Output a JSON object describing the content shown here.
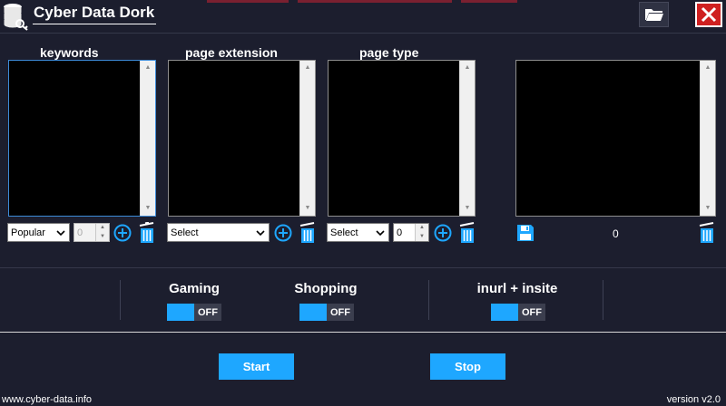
{
  "window": {
    "title": "Cyber Data Dork"
  },
  "icons": {
    "app": "database-key-icon",
    "folder": "folder-open-icon",
    "close": "close-x-icon",
    "add": "plus-circle-icon",
    "delete": "trash-icon",
    "save": "floppy-disk-icon"
  },
  "groups": {
    "keywords": {
      "title": "keywords",
      "select_value": "Popular",
      "spinner_value": "0"
    },
    "page_extension": {
      "title": "page extension",
      "select_value": "Select"
    },
    "page_type": {
      "title": "page type",
      "select_value": "Select",
      "spinner_value": "0"
    },
    "results": {
      "count": "0"
    }
  },
  "toggles": [
    {
      "label": "Gaming",
      "state": "OFF"
    },
    {
      "label": "Shopping",
      "state": "OFF"
    },
    {
      "label": "inurl + insite",
      "state": "OFF"
    }
  ],
  "actions": {
    "start": "Start",
    "stop": "Stop"
  },
  "footer": {
    "website": "www.cyber-data.info",
    "version": "version v2.0"
  },
  "colors": {
    "background": "#1c1e2e",
    "accent": "#1ea7ff",
    "close": "#cf2020",
    "panel": "#000000"
  }
}
